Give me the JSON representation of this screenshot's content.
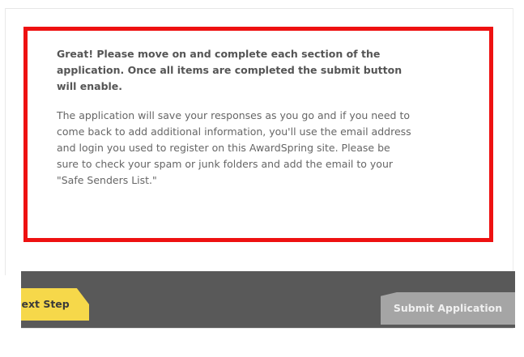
{
  "message": {
    "headline": "Great! Please move on and complete each section of the application. Once all items are completed the submit button will enable.",
    "body": "The application will save your responses as you go and if you need to come back to add additional information, you'll use the email address and login you used to register on this AwardSpring site. Please be sure to check your spam or junk folders and add the email to your \"Safe Senders List.\""
  },
  "actions": {
    "next_step_label": "Next Step",
    "submit_label": "Submit Application",
    "submit_enabled": false
  },
  "colors": {
    "highlight_border": "#ee1111",
    "action_bar": "#595959",
    "next_step_bg": "#f6d84a",
    "submit_disabled_bg": "#a5a5a5"
  }
}
